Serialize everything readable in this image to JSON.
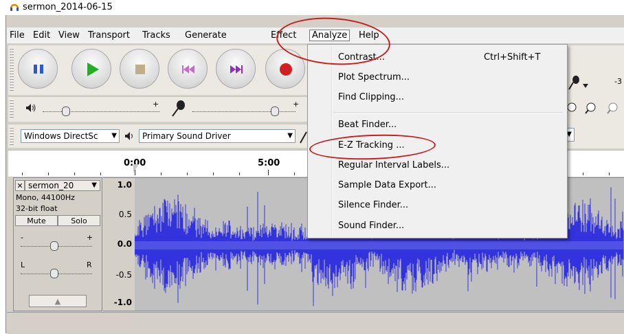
{
  "window": {
    "title": "sermon_2014-06-15"
  },
  "menubar": {
    "items": [
      "File",
      "Edit",
      "View",
      "Transport",
      "Tracks",
      "Generate",
      "Effect",
      "Analyze",
      "Help"
    ]
  },
  "analyze_menu": {
    "groups": [
      [
        {
          "label": "Contrast...",
          "shortcut": "Ctrl+Shift+T"
        },
        {
          "label": "Plot Spectrum..."
        },
        {
          "label": "Find Clipping..."
        }
      ],
      [
        {
          "label": "Beat Finder..."
        },
        {
          "label": "E-Z Tracking ..."
        },
        {
          "label": "Regular Interval Labels..."
        },
        {
          "label": "Sample Data Export..."
        },
        {
          "label": "Silence Finder..."
        },
        {
          "label": "Sound Finder..."
        }
      ]
    ]
  },
  "device_toolbar": {
    "host": "Windows DirectSc",
    "output_device": "Primary Sound Driver"
  },
  "meter": {
    "partial_label": "-3"
  },
  "ruler": {
    "labels": [
      "0:00",
      "5:00"
    ]
  },
  "track": {
    "name": "sermon_20",
    "format_line1": "Mono, 44100Hz",
    "format_line2": "32-bit float",
    "mute_label": "Mute",
    "solo_label": "Solo",
    "gain_minus": "-",
    "gain_plus": "+",
    "pan_left": "L",
    "pan_right": "R",
    "amplitude_labels": [
      "1.0",
      "0.5",
      "0.0",
      "-0.5",
      "-1.0"
    ]
  },
  "colors": {
    "waveform": "#3333dd",
    "waveform_bg": "#c0c0c0",
    "annotation": "#c32020",
    "record": "#d02020",
    "play": "#22b022"
  }
}
